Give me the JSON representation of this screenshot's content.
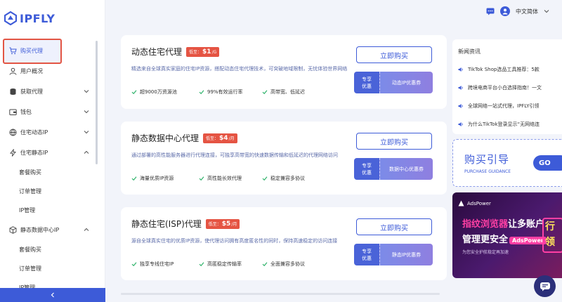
{
  "brand": {
    "name": "IPFLY"
  },
  "sidebar": {
    "items": [
      {
        "label": "购买代理",
        "icon": "cart-icon",
        "active": true,
        "chevron": ""
      },
      {
        "label": "用户概况",
        "icon": "user-icon",
        "chevron": ""
      },
      {
        "label": "获取代理",
        "icon": "database-icon",
        "chevron": "down"
      },
      {
        "label": "钱包",
        "icon": "wallet-icon",
        "chevron": "down"
      },
      {
        "label": "住宅动态IP",
        "icon": "globe-icon",
        "chevron": "down"
      },
      {
        "label": "住宅静态IP",
        "icon": "lightning-icon",
        "chevron": "up"
      },
      {
        "label": "套餐购买",
        "sub": true
      },
      {
        "label": "订单管理",
        "sub": true
      },
      {
        "label": "IP管理",
        "sub": true
      },
      {
        "label": "静态数据中心IP",
        "icon": "box-icon",
        "chevron": "up"
      },
      {
        "label": "套餐购买",
        "sub": true
      },
      {
        "label": "订单管理",
        "sub": true
      },
      {
        "label": "IP管理",
        "sub": true
      }
    ]
  },
  "header": {
    "language": "中文简体"
  },
  "cards": [
    {
      "title": "动态住宅代理",
      "price_prefix": "低至：",
      "price_value": "$1",
      "price_unit": "/G",
      "description": "精选来自全球真实家庭的住宅IP资源，搭配动态住宅代理技术，可突破地域限制，无忧体验世界网络",
      "features": [
        "超9000万资源池",
        "99%有效运行率",
        "高带宽、低延迟"
      ],
      "buy_label": "立即购买",
      "coupon_left": [
        "专享",
        "优惠"
      ],
      "coupon_right": "动态IP优惠券"
    },
    {
      "title": "静态数据中心代理",
      "price_prefix": "低至：",
      "price_value": "$4",
      "price_unit": "/月",
      "description": "通过部署的高性能服务器进行代理连接，可独享高带宽的快速数据传输和低延迟的代理网络访问",
      "features": [
        "海量优质IP资源",
        "高性能长效代理",
        "稳定兼容多协议"
      ],
      "buy_label": "立即购买",
      "coupon_left": [
        "专享",
        "优惠"
      ],
      "coupon_right": "数据中心优惠券"
    },
    {
      "title": "静态住宅(ISP)代理",
      "price_prefix": "低至：",
      "price_value": "$5",
      "price_unit": "/月",
      "description": "源自全球真实住宅的优质IP资源，使代理访问拥有高度匿名性的同时，保持高速稳定的访问连接",
      "features": [
        "独享专线住宅IP",
        "高匿稳定传输率",
        "全面兼容多协议"
      ],
      "buy_label": "立即购买",
      "coupon_left": [
        "专享",
        "优惠"
      ],
      "coupon_right": "静态IP优惠券"
    }
  ],
  "news": {
    "title": "新闻资讯",
    "items": [
      "TikTok Shop选品工具推荐：5款",
      "跨境电商平台小白选择指南！一文",
      "全球网络一站式代理，IPFLY引领",
      "为什么TikTok登录显示“无网络连"
    ]
  },
  "guide": {
    "title": "购买引导",
    "subtitle": "PURCHASE GUIDANCE",
    "button": "GO"
  },
  "ad": {
    "brand": "AdsPower",
    "line1_a": "指纹浏览器",
    "line1_b": "让多账户",
    "line2_a": "管理更安全",
    "line2_pill": "AdsPower",
    "line3": "为您安全护航稳定再加速",
    "side_text": "行\n领"
  },
  "colors": {
    "accent": "#3d5bd8",
    "price": "#e55443",
    "highlight": "#e25544"
  }
}
